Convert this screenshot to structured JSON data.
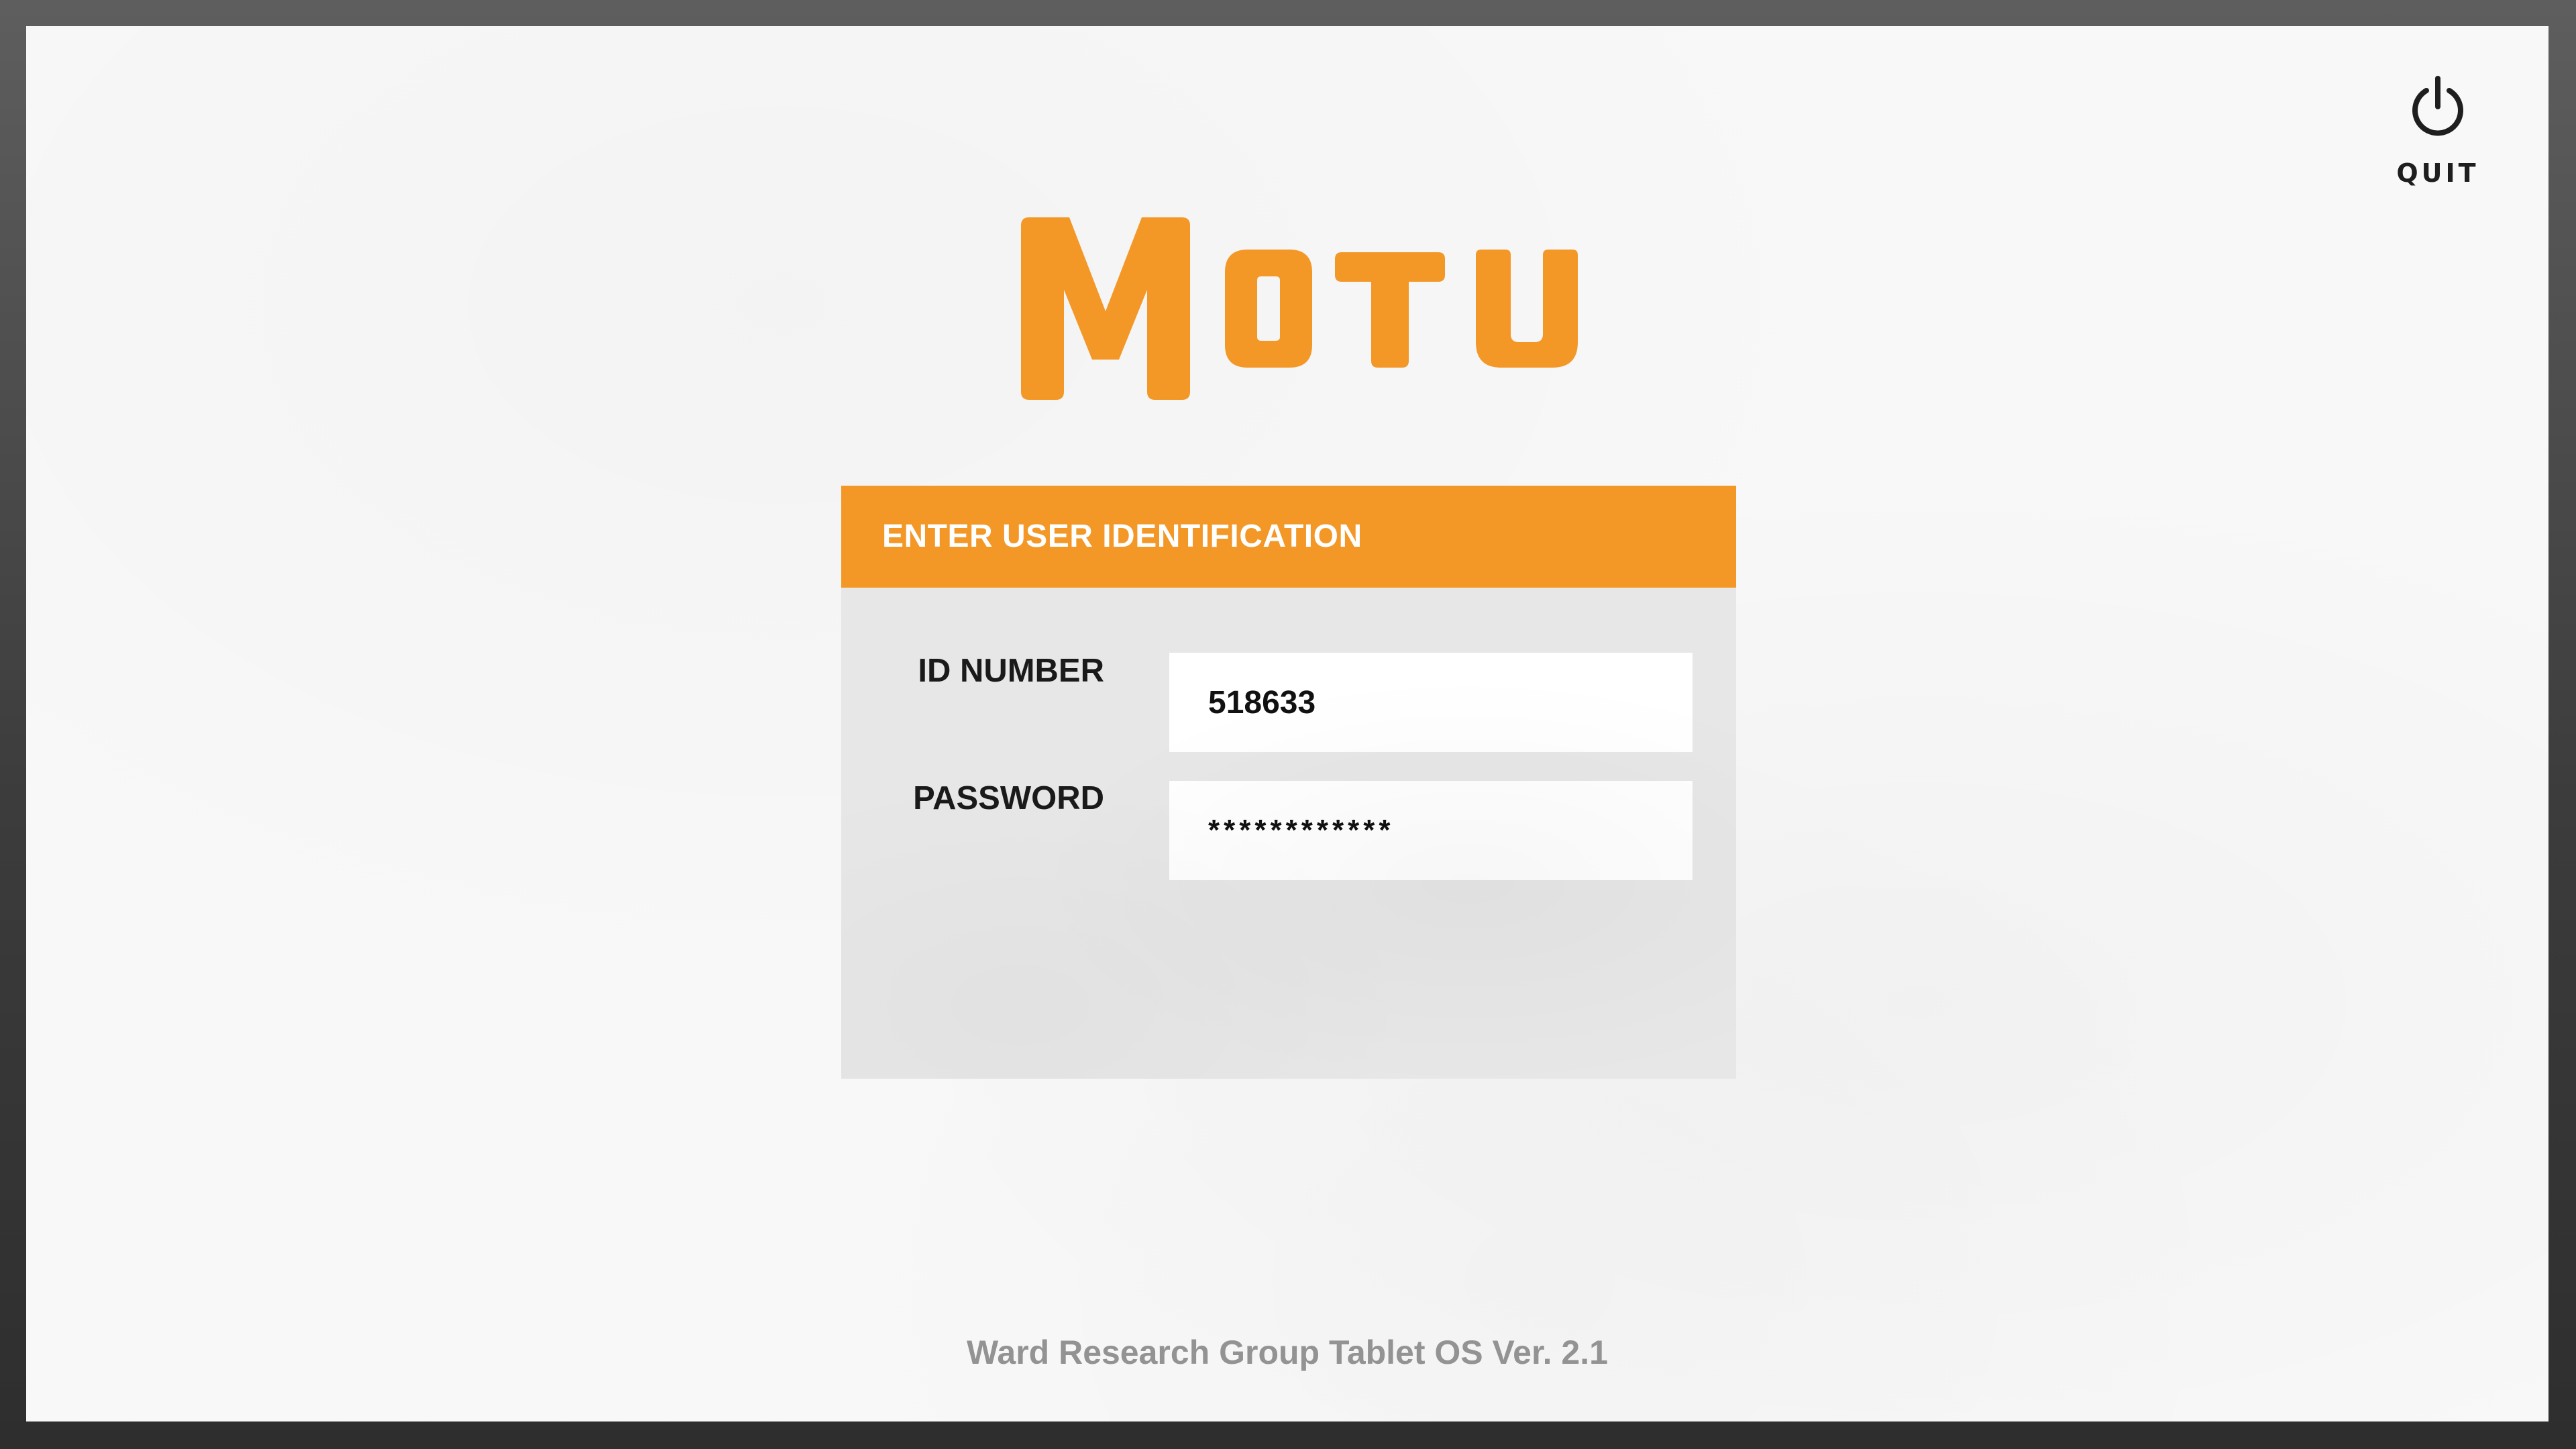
{
  "quit": {
    "label": "QUIT",
    "icon": "power-icon"
  },
  "logo": {
    "text": "MOTU",
    "color": "#F39727"
  },
  "login": {
    "header": "ENTER USER IDENTIFICATION",
    "id_label": "ID NUMBER",
    "id_value": "518633",
    "password_label": "PASSWORD",
    "password_value": "************"
  },
  "footer": {
    "text": "Ward Research Group Tablet OS Ver. 2.1"
  },
  "colors": {
    "accent": "#F39727",
    "background": "#F8F8F8",
    "card": "#E7E7E7",
    "footer_text": "#939393"
  }
}
